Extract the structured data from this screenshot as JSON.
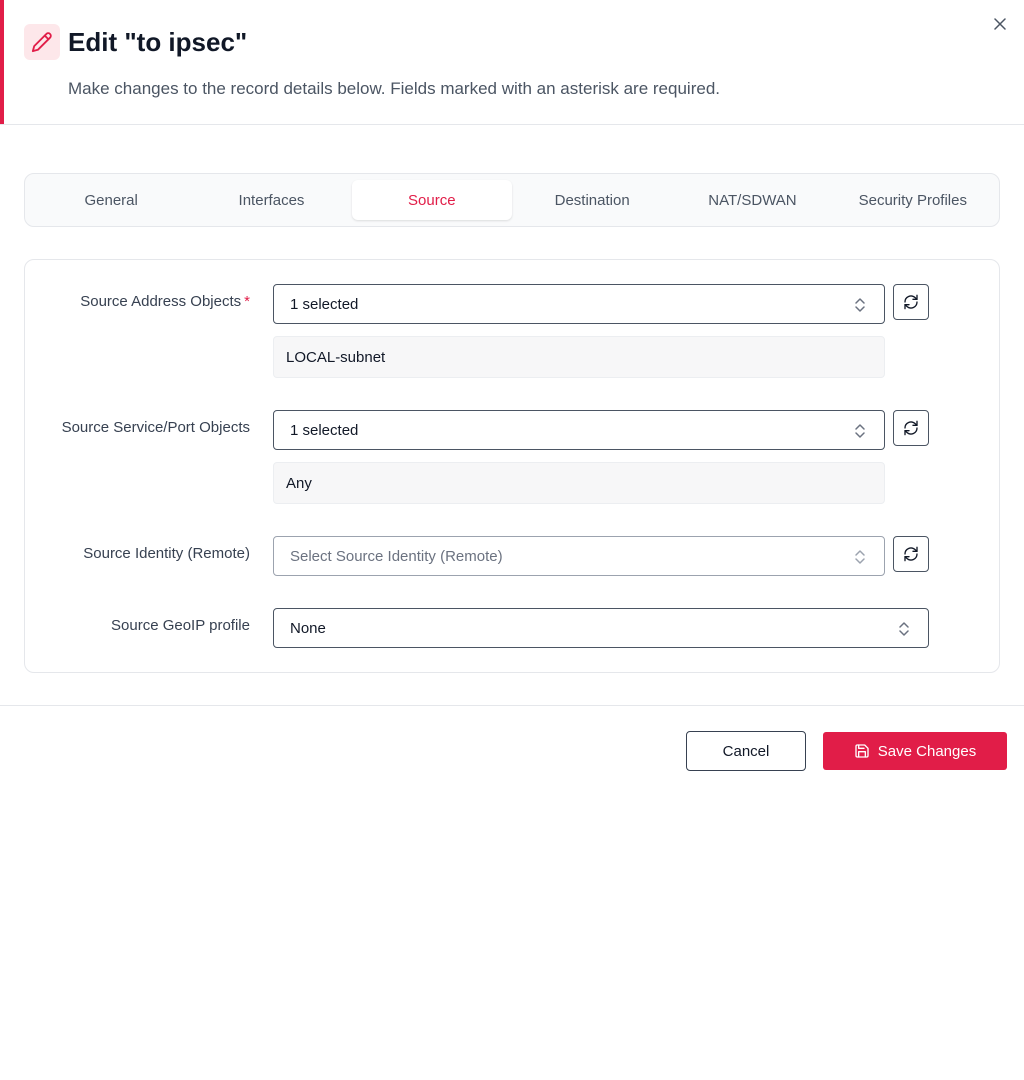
{
  "dialog": {
    "title": "Edit \"to ipsec\"",
    "subtitle": "Make changes to the record details below. Fields marked with an asterisk are required.",
    "icon": "pencil-icon",
    "accent_color": "#e11d48"
  },
  "tabs": [
    {
      "label": "General",
      "active": false
    },
    {
      "label": "Interfaces",
      "active": false
    },
    {
      "label": "Source",
      "active": true
    },
    {
      "label": "Destination",
      "active": false
    },
    {
      "label": "NAT/SDWAN",
      "active": false
    },
    {
      "label": "Security Profiles",
      "active": false
    }
  ],
  "fields": {
    "source_address": {
      "label": "Source Address Objects",
      "required_mark": "*",
      "value": "1 selected",
      "selected_items": [
        "LOCAL-subnet"
      ]
    },
    "source_service": {
      "label": "Source Service/Port Objects",
      "value": "1 selected",
      "selected_items": [
        "Any"
      ]
    },
    "source_identity": {
      "label": "Source Identity (Remote)",
      "placeholder": "Select Source Identity (Remote)"
    },
    "source_geoip": {
      "label": "Source GeoIP profile",
      "value": "None"
    }
  },
  "footer": {
    "cancel_label": "Cancel",
    "save_label": "Save Changes"
  }
}
